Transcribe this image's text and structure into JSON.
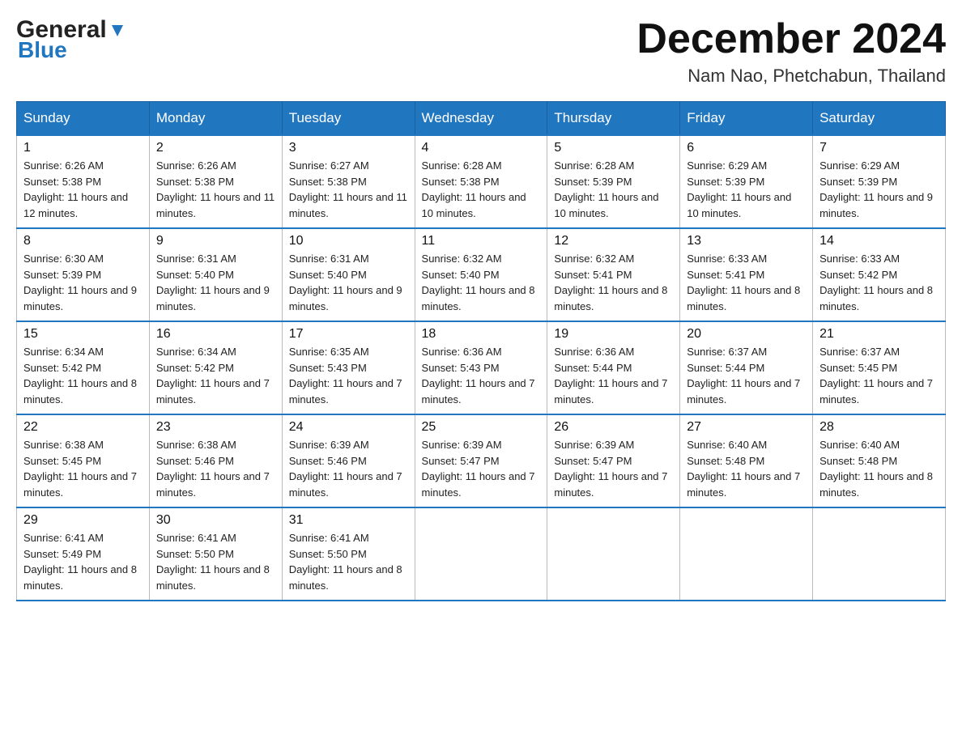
{
  "header": {
    "logo_general": "General",
    "logo_blue": "Blue",
    "main_title": "December 2024",
    "subtitle": "Nam Nao, Phetchabun, Thailand"
  },
  "days_of_week": [
    "Sunday",
    "Monday",
    "Tuesday",
    "Wednesday",
    "Thursday",
    "Friday",
    "Saturday"
  ],
  "weeks": [
    [
      {
        "day": "1",
        "sunrise": "6:26 AM",
        "sunset": "5:38 PM",
        "daylight": "11 hours and 12 minutes."
      },
      {
        "day": "2",
        "sunrise": "6:26 AM",
        "sunset": "5:38 PM",
        "daylight": "11 hours and 11 minutes."
      },
      {
        "day": "3",
        "sunrise": "6:27 AM",
        "sunset": "5:38 PM",
        "daylight": "11 hours and 11 minutes."
      },
      {
        "day": "4",
        "sunrise": "6:28 AM",
        "sunset": "5:38 PM",
        "daylight": "11 hours and 10 minutes."
      },
      {
        "day": "5",
        "sunrise": "6:28 AM",
        "sunset": "5:39 PM",
        "daylight": "11 hours and 10 minutes."
      },
      {
        "day": "6",
        "sunrise": "6:29 AM",
        "sunset": "5:39 PM",
        "daylight": "11 hours and 10 minutes."
      },
      {
        "day": "7",
        "sunrise": "6:29 AM",
        "sunset": "5:39 PM",
        "daylight": "11 hours and 9 minutes."
      }
    ],
    [
      {
        "day": "8",
        "sunrise": "6:30 AM",
        "sunset": "5:39 PM",
        "daylight": "11 hours and 9 minutes."
      },
      {
        "day": "9",
        "sunrise": "6:31 AM",
        "sunset": "5:40 PM",
        "daylight": "11 hours and 9 minutes."
      },
      {
        "day": "10",
        "sunrise": "6:31 AM",
        "sunset": "5:40 PM",
        "daylight": "11 hours and 9 minutes."
      },
      {
        "day": "11",
        "sunrise": "6:32 AM",
        "sunset": "5:40 PM",
        "daylight": "11 hours and 8 minutes."
      },
      {
        "day": "12",
        "sunrise": "6:32 AM",
        "sunset": "5:41 PM",
        "daylight": "11 hours and 8 minutes."
      },
      {
        "day": "13",
        "sunrise": "6:33 AM",
        "sunset": "5:41 PM",
        "daylight": "11 hours and 8 minutes."
      },
      {
        "day": "14",
        "sunrise": "6:33 AM",
        "sunset": "5:42 PM",
        "daylight": "11 hours and 8 minutes."
      }
    ],
    [
      {
        "day": "15",
        "sunrise": "6:34 AM",
        "sunset": "5:42 PM",
        "daylight": "11 hours and 8 minutes."
      },
      {
        "day": "16",
        "sunrise": "6:34 AM",
        "sunset": "5:42 PM",
        "daylight": "11 hours and 7 minutes."
      },
      {
        "day": "17",
        "sunrise": "6:35 AM",
        "sunset": "5:43 PM",
        "daylight": "11 hours and 7 minutes."
      },
      {
        "day": "18",
        "sunrise": "6:36 AM",
        "sunset": "5:43 PM",
        "daylight": "11 hours and 7 minutes."
      },
      {
        "day": "19",
        "sunrise": "6:36 AM",
        "sunset": "5:44 PM",
        "daylight": "11 hours and 7 minutes."
      },
      {
        "day": "20",
        "sunrise": "6:37 AM",
        "sunset": "5:44 PM",
        "daylight": "11 hours and 7 minutes."
      },
      {
        "day": "21",
        "sunrise": "6:37 AM",
        "sunset": "5:45 PM",
        "daylight": "11 hours and 7 minutes."
      }
    ],
    [
      {
        "day": "22",
        "sunrise": "6:38 AM",
        "sunset": "5:45 PM",
        "daylight": "11 hours and 7 minutes."
      },
      {
        "day": "23",
        "sunrise": "6:38 AM",
        "sunset": "5:46 PM",
        "daylight": "11 hours and 7 minutes."
      },
      {
        "day": "24",
        "sunrise": "6:39 AM",
        "sunset": "5:46 PM",
        "daylight": "11 hours and 7 minutes."
      },
      {
        "day": "25",
        "sunrise": "6:39 AM",
        "sunset": "5:47 PM",
        "daylight": "11 hours and 7 minutes."
      },
      {
        "day": "26",
        "sunrise": "6:39 AM",
        "sunset": "5:47 PM",
        "daylight": "11 hours and 7 minutes."
      },
      {
        "day": "27",
        "sunrise": "6:40 AM",
        "sunset": "5:48 PM",
        "daylight": "11 hours and 7 minutes."
      },
      {
        "day": "28",
        "sunrise": "6:40 AM",
        "sunset": "5:48 PM",
        "daylight": "11 hours and 8 minutes."
      }
    ],
    [
      {
        "day": "29",
        "sunrise": "6:41 AM",
        "sunset": "5:49 PM",
        "daylight": "11 hours and 8 minutes."
      },
      {
        "day": "30",
        "sunrise": "6:41 AM",
        "sunset": "5:50 PM",
        "daylight": "11 hours and 8 minutes."
      },
      {
        "day": "31",
        "sunrise": "6:41 AM",
        "sunset": "5:50 PM",
        "daylight": "11 hours and 8 minutes."
      },
      null,
      null,
      null,
      null
    ]
  ],
  "labels": {
    "sunrise": "Sunrise: ",
    "sunset": "Sunset: ",
    "daylight": "Daylight: "
  }
}
